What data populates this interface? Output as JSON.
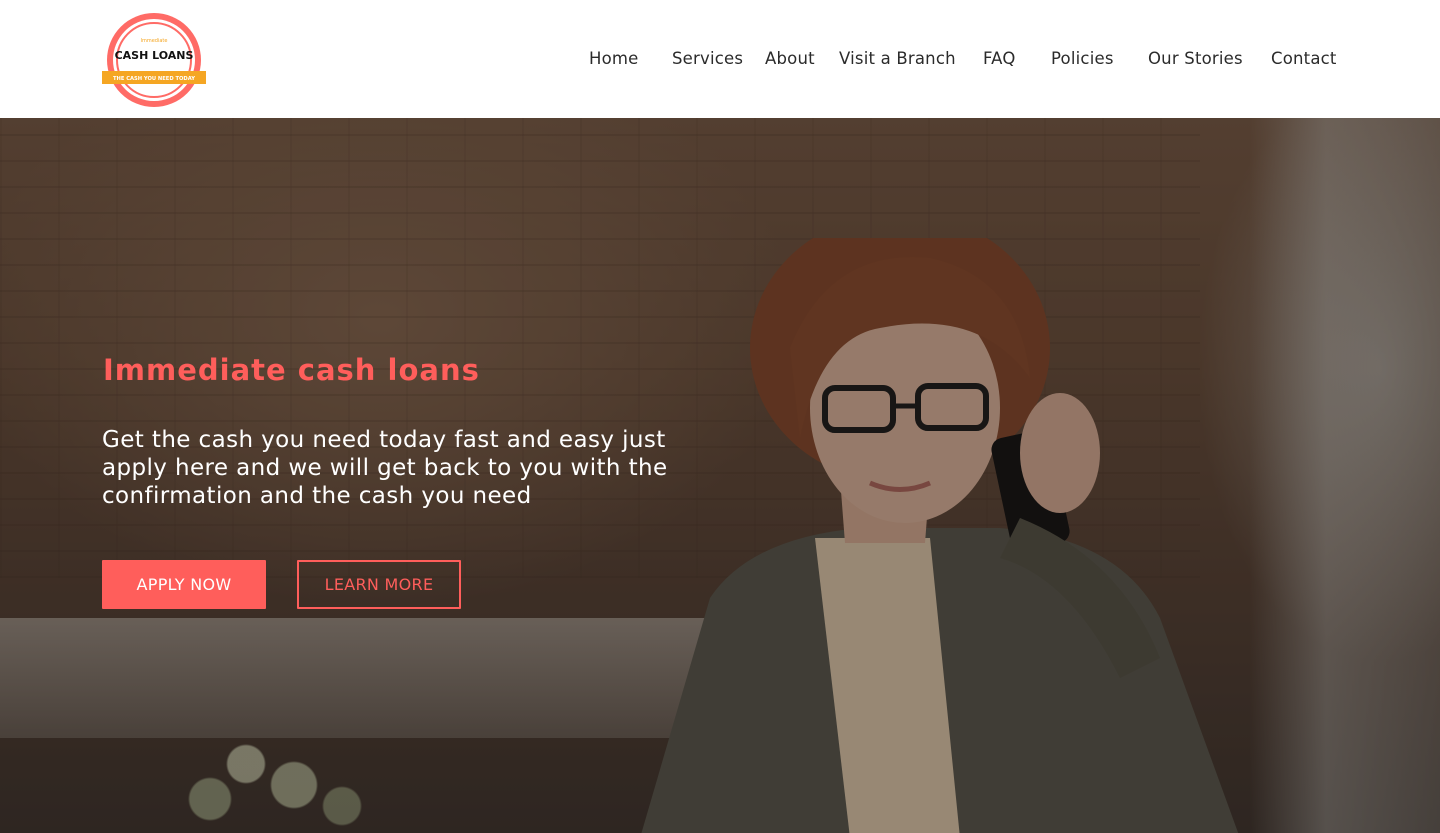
{
  "brand": {
    "logo_small": "Immediate",
    "logo_name": "CASH LOANS",
    "logo_tagline": "THE CASH YOU NEED TODAY"
  },
  "nav": {
    "items": [
      {
        "label": "Home"
      },
      {
        "label": "Services"
      },
      {
        "label": "About"
      },
      {
        "label": "Visit a Branch"
      },
      {
        "label": "FAQ"
      },
      {
        "label": "Policies"
      },
      {
        "label": "Our Stories"
      },
      {
        "label": "Contact"
      }
    ]
  },
  "hero": {
    "title": "Immediate cash loans",
    "text": "Get the cash you need today fast and easy just apply here and we will get back to you with the confirmation and the cash you need",
    "apply_label": "APPLY NOW",
    "learn_label": "LEARN MORE"
  },
  "colors": {
    "accent": "#ff5e5b",
    "logo_band": "#f5a623",
    "text_dark": "#2b2b2b"
  }
}
